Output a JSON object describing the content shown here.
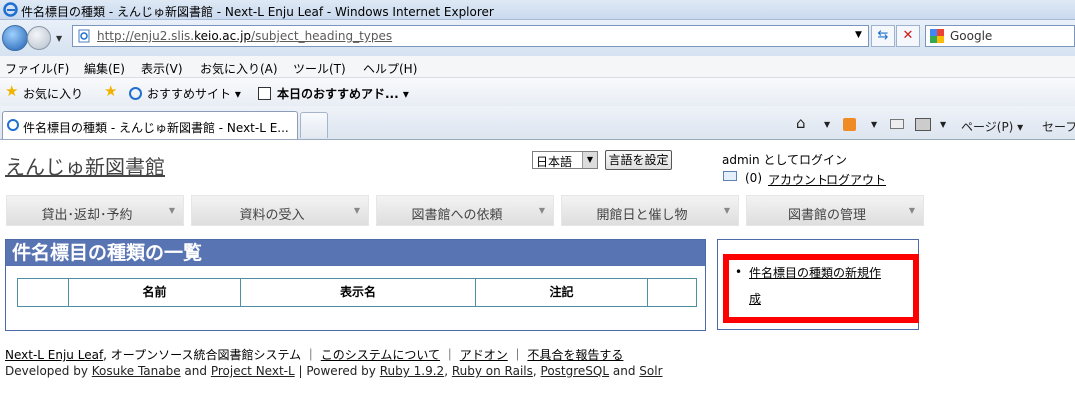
{
  "window": {
    "title": "件名標目の種類 - えんじゅ新図書館 - Next-L Enju Leaf - Windows Internet Explorer"
  },
  "browser": {
    "address": {
      "prefix": "http://enju2.slis.",
      "domain": "keio.ac.jp",
      "suffix": "/subject_heading_types"
    },
    "search_placeholder": "Google",
    "menu": [
      "ファイル(F)",
      "編集(E)",
      "表示(V)",
      "お気に入り(A)",
      "ツール(T)",
      "ヘルプ(H)"
    ],
    "favorites": {
      "label": "お気に入り",
      "items": [
        "おすすめサイト ▾",
        "本日のおすすめアド... ▾"
      ]
    },
    "tab_title": "件名標目の種類 - えんじゅ新図書館 - Next-L E...",
    "toolbar": {
      "page": "ページ(P) ▾",
      "safety": "セーフ"
    }
  },
  "site": {
    "title": "えんじゅ新図書館",
    "language_selected": "日本語",
    "language_button": "言語を設定",
    "login_text": "admin としてログイン",
    "message_count": "(0)",
    "account": "アカウント",
    "logout": "ログアウト"
  },
  "nav": [
    "貸出･返却･予約",
    "資料の受入",
    "図書館への依頼",
    "開館日と催し物",
    "図書館の管理"
  ],
  "main": {
    "heading": "件名標目の種類の一覧",
    "columns": [
      "",
      "名前",
      "表示名",
      "注記",
      ""
    ]
  },
  "sidebar": {
    "new_link_line1": "件名標目の種類の新規作",
    "new_link_line2": "成"
  },
  "footer": {
    "enju_link": "Next-L Enju Leaf",
    "tagline": ", オープンソース統合図書館システム ｜",
    "about": "このシステムについて",
    "sep": "｜",
    "addon": "アドオン",
    "report": "不具合を報告する",
    "dev_prefix": "Developed by ",
    "dev_name": "Kosuke Tanabe",
    "and": " and ",
    "project": "Project Next-L",
    "powered": " | Powered by ",
    "ruby": "Ruby 1.9.2",
    "comma": ", ",
    "rails": "Ruby on Rails",
    "postgres": "PostgreSQL",
    "solr": "Solr"
  },
  "colors": {
    "heading_bg": "#5874b3",
    "highlight": "#ff0000",
    "table_border": "#4e8fa4"
  }
}
